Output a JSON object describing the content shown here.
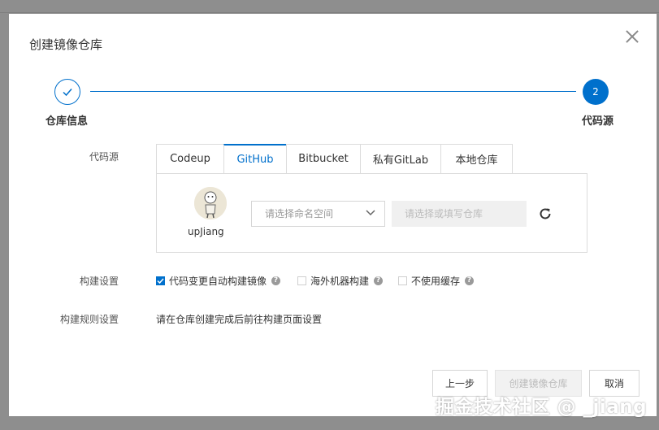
{
  "dialog": {
    "title": "创建镜像仓库"
  },
  "steps": [
    {
      "label": "仓库信息",
      "state": "done"
    },
    {
      "label": "代码源",
      "number": "2",
      "state": "active"
    }
  ],
  "code_source": {
    "label": "代码源",
    "tabs": [
      "Codeup",
      "GitHub",
      "Bitbucket",
      "私有GitLab",
      "本地仓库"
    ],
    "active_tab": "GitHub",
    "user": {
      "name": "upJiang"
    },
    "namespace_select": {
      "placeholder": "请选择命名空间"
    },
    "repo_input": {
      "placeholder": "请选择或填写仓库"
    }
  },
  "build_settings": {
    "label": "构建设置",
    "options": [
      {
        "label": "代码变更自动构建镜像",
        "checked": true
      },
      {
        "label": "海外机器构建",
        "checked": false
      },
      {
        "label": "不使用缓存",
        "checked": false
      }
    ]
  },
  "build_rules": {
    "label": "构建规则设置",
    "text": "请在仓库创建完成后前往构建页面设置"
  },
  "buttons": {
    "prev": "上一步",
    "create": "创建镜像仓库",
    "cancel": "取消"
  },
  "watermark": "掘金技术社区 @ _jiang",
  "colors": {
    "accent": "#0070cc"
  },
  "icons": [
    "close-icon",
    "check-icon",
    "chevron-down-icon",
    "refresh-icon",
    "help-icon"
  ]
}
